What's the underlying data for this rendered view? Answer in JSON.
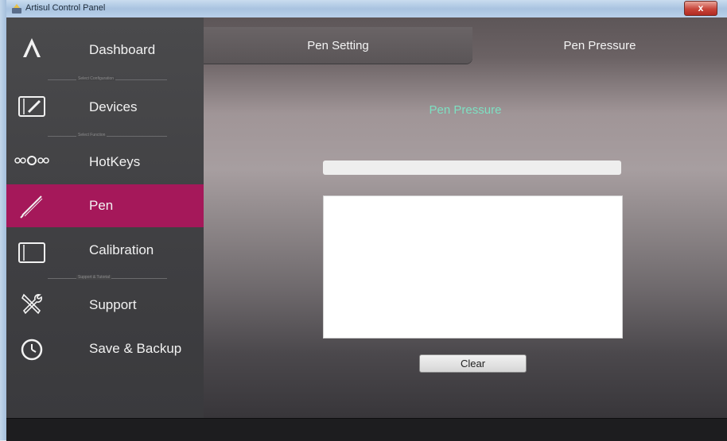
{
  "window": {
    "title": "Artisul Control Panel",
    "close_label": "x"
  },
  "sidebar": {
    "items": [
      {
        "label": "Dashboard",
        "icon": "artisul-logo-icon"
      },
      {
        "label": "Devices",
        "icon": "tablet-pen-icon"
      },
      {
        "label": "HotKeys",
        "icon": "hotkeys-dots-icon"
      },
      {
        "label": "Pen",
        "icon": "pen-icon",
        "active": true
      },
      {
        "label": "Calibration",
        "icon": "tablet-icon"
      },
      {
        "label": "Support",
        "icon": "tools-icon"
      },
      {
        "label": "Save & Backup",
        "icon": "clock-icon"
      }
    ],
    "separators": [
      "Select Configuration",
      "Select Function",
      "Support & Tutorial"
    ]
  },
  "tabs": [
    {
      "label": "Pen Setting",
      "active": false
    },
    {
      "label": "Pen Pressure",
      "active": true
    }
  ],
  "main": {
    "section_title": "Pen Pressure",
    "pressure_level": 0,
    "clear_label": "Clear"
  },
  "colors": {
    "accent_active": "#a5185a",
    "section_title": "#7de0c2",
    "sidebar_bg": "#434345"
  }
}
